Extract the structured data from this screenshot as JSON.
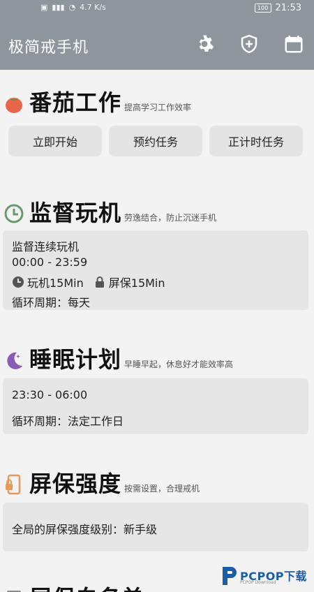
{
  "status_bar": {
    "signal_text": "4.7 K/s",
    "time": "21:53",
    "battery": "100"
  },
  "app_bar": {
    "title": "极简戒手机",
    "icons": [
      "gear-icon",
      "shield-plus-icon",
      "calendar-icon"
    ]
  },
  "sections": {
    "pomodoro": {
      "title": "番茄工作",
      "subtitle": "提高学习工作效率",
      "icon": "tomato-icon",
      "buttons": [
        "立即开始",
        "预约任务",
        "正计时任务"
      ]
    },
    "supervise": {
      "title": "监督玩机",
      "subtitle": "劳逸结合，防止沉迷手机",
      "icon": "clock-icon",
      "card": {
        "name": "监督连续玩机",
        "time_range": "00:00 - 23:59",
        "play_label": "玩机15Min",
        "lock_label": "屏保15Min",
        "cycle": "循环周期：每天"
      }
    },
    "sleep": {
      "title": "睡眠计划",
      "subtitle": "早睡早起，休息好才能效率高",
      "icon": "moon-icon",
      "card": {
        "time_range": "23:30 - 06:00",
        "cycle": "循环周期：法定工作日"
      }
    },
    "strength": {
      "title": "屏保强度",
      "subtitle": "按需设置，合理戒机",
      "icon": "phone-lock-icon",
      "card": {
        "level": "全局的屏保强度级别：新手级"
      }
    },
    "whitelist": {
      "title": "屏保白名单"
    }
  },
  "watermark": {
    "text": "PCPOP下载",
    "sub": "PCPOP Download"
  },
  "colors": {
    "appbar": "#8e959c",
    "tomato": "#e8674a",
    "clock": "#6a9a6c",
    "moon": "#8a5ab8",
    "phone": "#e59a5a",
    "card": "#e6e6e6",
    "watermark": "#1b5ea8"
  }
}
